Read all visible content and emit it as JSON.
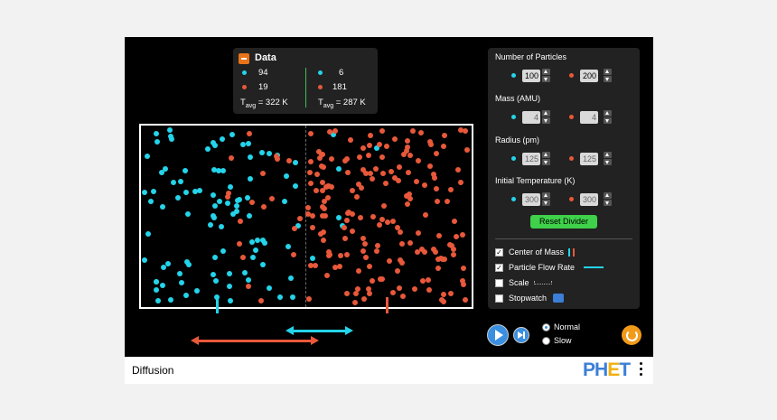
{
  "data_panel": {
    "title": "Data",
    "left": {
      "cyan_count": "94",
      "red_count": "19",
      "tavg_label": "T",
      "tavg_sub": "avg",
      "tavg_value": " = 322 K"
    },
    "right": {
      "cyan_count": "6",
      "red_count": "181",
      "tavg_label": "T",
      "tavg_sub": "avg",
      "tavg_value": " = 287 K"
    }
  },
  "controls": {
    "num_particles_label": "Number of Particles",
    "num_particles": {
      "cyan": "100",
      "red": "200"
    },
    "mass_label": "Mass (AMU)",
    "mass": {
      "cyan": "4",
      "red": "4"
    },
    "radius_label": "Radius (pm)",
    "radius": {
      "cyan": "125",
      "red": "125"
    },
    "temp_label": "Initial Temperature (K)",
    "temp": {
      "cyan": "300",
      "red": "300"
    },
    "reset_divider": "Reset Divider"
  },
  "checkboxes": [
    {
      "label": "Center of Mass",
      "checked": true
    },
    {
      "label": "Particle Flow Rate",
      "checked": true
    },
    {
      "label": "Scale",
      "checked": false
    },
    {
      "label": "Stopwatch",
      "checked": false
    }
  ],
  "speed": {
    "normal": "Normal",
    "slow": "Slow",
    "selected": "Normal"
  },
  "navbar": {
    "title": "Diffusion",
    "logo_ph": "PH",
    "logo_e": "E",
    "logo_t": "T"
  },
  "colors": {
    "cyan": "#24d4ea",
    "red": "#e8583a",
    "reset_green": "#3fd14a",
    "accent_blue": "#3b8fe0"
  },
  "icons": [
    "collapse-icon",
    "play-icon",
    "step-forward-icon",
    "reset-all-icon",
    "menu-dots-icon"
  ]
}
